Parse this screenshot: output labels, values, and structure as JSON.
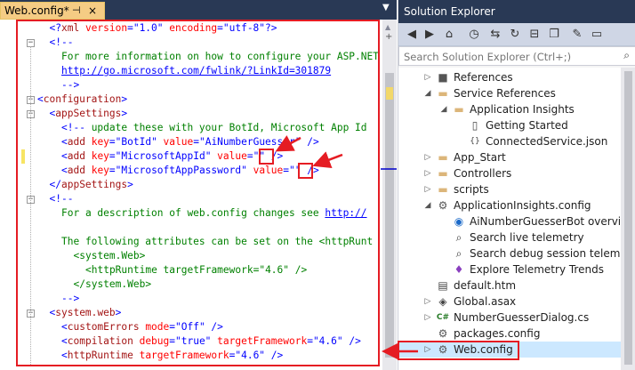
{
  "editor": {
    "tab": {
      "title": "Web.config*",
      "pin": "⊣",
      "close": "×"
    },
    "lines": [
      {
        "indent": 1,
        "parts": [
          {
            "c": "b",
            "t": "<?"
          },
          {
            "c": "t",
            "t": "xml"
          },
          {
            "c": "a",
            "t": " version"
          },
          {
            "c": "b",
            "t": "=\"1.0\""
          },
          {
            "c": "a",
            "t": " encoding"
          },
          {
            "c": "b",
            "t": "=\"utf-8\"?>"
          }
        ]
      },
      {
        "indent": 1,
        "fold": "−",
        "parts": [
          {
            "c": "b",
            "t": "<!--"
          }
        ]
      },
      {
        "indent": 2,
        "parts": [
          {
            "c": "cm",
            "t": "For more information on how to configure your ASP.NET"
          }
        ]
      },
      {
        "indent": 2,
        "parts": [
          {
            "c": "lk",
            "t": "http://go.microsoft.com/fwlink/?LinkId=301879"
          }
        ]
      },
      {
        "indent": 2,
        "parts": [
          {
            "c": "b",
            "t": "-->"
          }
        ]
      },
      {
        "indent": 0,
        "fold": "−",
        "parts": [
          {
            "c": "b",
            "t": "<"
          },
          {
            "c": "t",
            "t": "configuration"
          },
          {
            "c": "b",
            "t": ">"
          }
        ]
      },
      {
        "indent": 1,
        "fold": "−",
        "parts": [
          {
            "c": "b",
            "t": "<"
          },
          {
            "c": "t",
            "t": "appSettings"
          },
          {
            "c": "b",
            "t": ">"
          }
        ]
      },
      {
        "indent": 2,
        "parts": [
          {
            "c": "b",
            "t": "<!--"
          },
          {
            "c": "cm",
            "t": " update these with your BotId, Microsoft App Id"
          }
        ]
      },
      {
        "indent": 2,
        "parts": [
          {
            "c": "b",
            "t": "<"
          },
          {
            "c": "t",
            "t": "add"
          },
          {
            "c": "a",
            "t": " key"
          },
          {
            "c": "b",
            "t": "=\"BotId\""
          },
          {
            "c": "a",
            "t": " value"
          },
          {
            "c": "b",
            "t": "=\"AiNumberGuesser\""
          },
          {
            "c": "b",
            "t": " />"
          }
        ]
      },
      {
        "indent": 2,
        "changed": true,
        "parts": [
          {
            "c": "b",
            "t": "<"
          },
          {
            "c": "t",
            "t": "add"
          },
          {
            "c": "a",
            "t": " key"
          },
          {
            "c": "b",
            "t": "=\"MicrosoftAppId\""
          },
          {
            "c": "a",
            "t": " value"
          },
          {
            "c": "b",
            "t": "=\"\""
          },
          {
            "c": "b",
            "t": " />"
          }
        ]
      },
      {
        "indent": 2,
        "parts": [
          {
            "c": "b",
            "t": "<"
          },
          {
            "c": "t",
            "t": "add"
          },
          {
            "c": "a",
            "t": " key"
          },
          {
            "c": "b",
            "t": "=\"MicrosoftAppPassword\""
          },
          {
            "c": "a",
            "t": " value"
          },
          {
            "c": "b",
            "t": "=\"\""
          },
          {
            "c": "b",
            "t": " />"
          }
        ]
      },
      {
        "indent": 1,
        "parts": [
          {
            "c": "b",
            "t": "</"
          },
          {
            "c": "t",
            "t": "appSettings"
          },
          {
            "c": "b",
            "t": ">"
          }
        ]
      },
      {
        "indent": 1,
        "fold": "−",
        "parts": [
          {
            "c": "b",
            "t": "<!--"
          }
        ]
      },
      {
        "indent": 2,
        "parts": [
          {
            "c": "cm",
            "t": "For a description of web.config changes see "
          },
          {
            "c": "lk",
            "t": "http://"
          }
        ]
      },
      {
        "indent": 2,
        "parts": []
      },
      {
        "indent": 2,
        "parts": [
          {
            "c": "cm",
            "t": "The following attributes can be set on the <httpRunt"
          }
        ]
      },
      {
        "indent": 3,
        "parts": [
          {
            "c": "cm",
            "t": "<system.Web>"
          }
        ]
      },
      {
        "indent": 4,
        "parts": [
          {
            "c": "cm",
            "t": "<httpRuntime targetFramework=\"4.6\" />"
          }
        ]
      },
      {
        "indent": 3,
        "parts": [
          {
            "c": "cm",
            "t": "</system.Web>"
          }
        ]
      },
      {
        "indent": 2,
        "parts": [
          {
            "c": "b",
            "t": "-->"
          }
        ]
      },
      {
        "indent": 1,
        "fold": "−",
        "parts": [
          {
            "c": "b",
            "t": "<"
          },
          {
            "c": "t",
            "t": "system.web"
          },
          {
            "c": "b",
            "t": ">"
          }
        ]
      },
      {
        "indent": 2,
        "parts": [
          {
            "c": "b",
            "t": "<"
          },
          {
            "c": "t",
            "t": "customErrors"
          },
          {
            "c": "a",
            "t": " mode"
          },
          {
            "c": "b",
            "t": "=\"Off\""
          },
          {
            "c": "b",
            "t": " />"
          }
        ]
      },
      {
        "indent": 2,
        "parts": [
          {
            "c": "b",
            "t": "<"
          },
          {
            "c": "t",
            "t": "compilation"
          },
          {
            "c": "a",
            "t": " debug"
          },
          {
            "c": "b",
            "t": "=\"true\""
          },
          {
            "c": "a",
            "t": " targetFramework"
          },
          {
            "c": "b",
            "t": "=\"4.6\""
          },
          {
            "c": "b",
            "t": " />"
          }
        ]
      },
      {
        "indent": 2,
        "parts": [
          {
            "c": "b",
            "t": "<"
          },
          {
            "c": "t",
            "t": "httpRuntime"
          },
          {
            "c": "a",
            "t": " targetFramework"
          },
          {
            "c": "b",
            "t": "=\"4.6\""
          },
          {
            "c": "b",
            "t": " />"
          }
        ]
      }
    ]
  },
  "solution_explorer": {
    "title": "Solution Explorer",
    "toolbar": [
      "back-icon",
      "forward-icon",
      "home-icon",
      "history-icon",
      "sync-icon",
      "refresh-icon",
      "collapse-icon",
      "show-all-icon",
      "properties-icon",
      "preview-icon"
    ],
    "search_placeholder": "Search Solution Explorer (Ctrl+;)",
    "items": [
      {
        "label": "References",
        "level": 1,
        "expander": "▷",
        "icon": "references-icon"
      },
      {
        "label": "Service References",
        "level": 1,
        "expander": "◢",
        "icon": "folder-icon"
      },
      {
        "label": "Application Insights",
        "level": 2,
        "expander": "◢",
        "icon": "folder-icon"
      },
      {
        "label": "Getting Started",
        "level": 3,
        "expander": "",
        "icon": "document-icon"
      },
      {
        "label": "ConnectedService.json",
        "level": 3,
        "expander": "",
        "icon": "json-icon"
      },
      {
        "label": "App_Start",
        "level": 1,
        "expander": "▷",
        "icon": "folder-icon"
      },
      {
        "label": "Controllers",
        "level": 1,
        "expander": "▷",
        "icon": "folder-icon"
      },
      {
        "label": "scripts",
        "level": 1,
        "expander": "▷",
        "icon": "folder-icon"
      },
      {
        "label": "ApplicationInsights.config",
        "level": 1,
        "expander": "◢",
        "icon": "config-icon"
      },
      {
        "label": "AiNumberGuesserBot overview",
        "level": 2,
        "expander": "",
        "icon": "insights-icon"
      },
      {
        "label": "Search live telemetry",
        "level": 2,
        "expander": "",
        "icon": "search-icon"
      },
      {
        "label": "Search debug session telemetry",
        "level": 2,
        "expander": "",
        "icon": "search-icon"
      },
      {
        "label": "Explore Telemetry Trends",
        "level": 2,
        "expander": "",
        "icon": "bulb-icon"
      },
      {
        "label": "default.htm",
        "level": 1,
        "expander": "",
        "icon": "html-icon"
      },
      {
        "label": "Global.asax",
        "level": 1,
        "expander": "▷",
        "icon": "asax-icon"
      },
      {
        "label": "NumberGuesserDialog.cs",
        "level": 1,
        "expander": "▷",
        "icon": "csharp-icon"
      },
      {
        "label": "packages.config",
        "level": 1,
        "expander": "",
        "icon": "config-icon"
      },
      {
        "label": "Web.config",
        "level": 1,
        "expander": "▷",
        "icon": "config-icon"
      }
    ]
  }
}
